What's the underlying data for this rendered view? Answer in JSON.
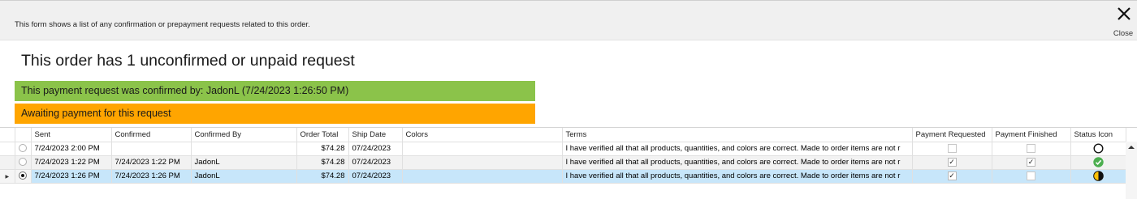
{
  "info_text": "This form shows a list of any confirmation or prepayment requests related to this order.",
  "close": {
    "label": "Close",
    "icon": "close-icon"
  },
  "heading": "This order has 1 unconfirmed or unpaid request",
  "banners": {
    "confirmed": "This payment request was confirmed by: JadonL (7/24/2023 1:26:50 PM)",
    "awaiting": "Awaiting payment for this request"
  },
  "colors": {
    "confirmed_banner": "#8bc34a",
    "awaiting_banner": "#ffa500",
    "selected_row": "#c7e6fa",
    "status_ok": "#4caf50",
    "status_partial": "#ffc107"
  },
  "grid": {
    "columns": [
      "Sent",
      "Confirmed",
      "Confirmed By",
      "Order Total",
      "Ship Date",
      "Colors",
      "Terms",
      "Payment Requested",
      "Payment Finished",
      "Status Icon"
    ],
    "rows": [
      {
        "sent": "7/24/2023 2:00 PM",
        "confirmed": "",
        "confirmed_by": "",
        "order_total": "$74.28",
        "ship_date": "07/24/2023",
        "colors": "",
        "terms": "I have verified all that all products, quantities, and colors are correct. Made to order items are not r",
        "payment_requested": false,
        "payment_finished": false,
        "status_icon": "empty-circle-icon",
        "selected": false
      },
      {
        "sent": "7/24/2023 1:22 PM",
        "confirmed": "7/24/2023 1:22 PM",
        "confirmed_by": "JadonL",
        "order_total": "$74.28",
        "ship_date": "07/24/2023",
        "colors": "",
        "terms": "I have verified all that all products, quantities, and colors are correct. Made to order items are not r",
        "payment_requested": true,
        "payment_finished": true,
        "status_icon": "green-check-icon",
        "selected": false
      },
      {
        "sent": "7/24/2023 1:26 PM",
        "confirmed": "7/24/2023 1:26 PM",
        "confirmed_by": "JadonL",
        "order_total": "$74.28",
        "ship_date": "07/24/2023",
        "colors": "",
        "terms": "I have verified all that all products, quantities, and colors are correct. Made to order items are not r",
        "payment_requested": true,
        "payment_finished": false,
        "status_icon": "half-filled-circle-icon",
        "selected": true
      }
    ]
  }
}
